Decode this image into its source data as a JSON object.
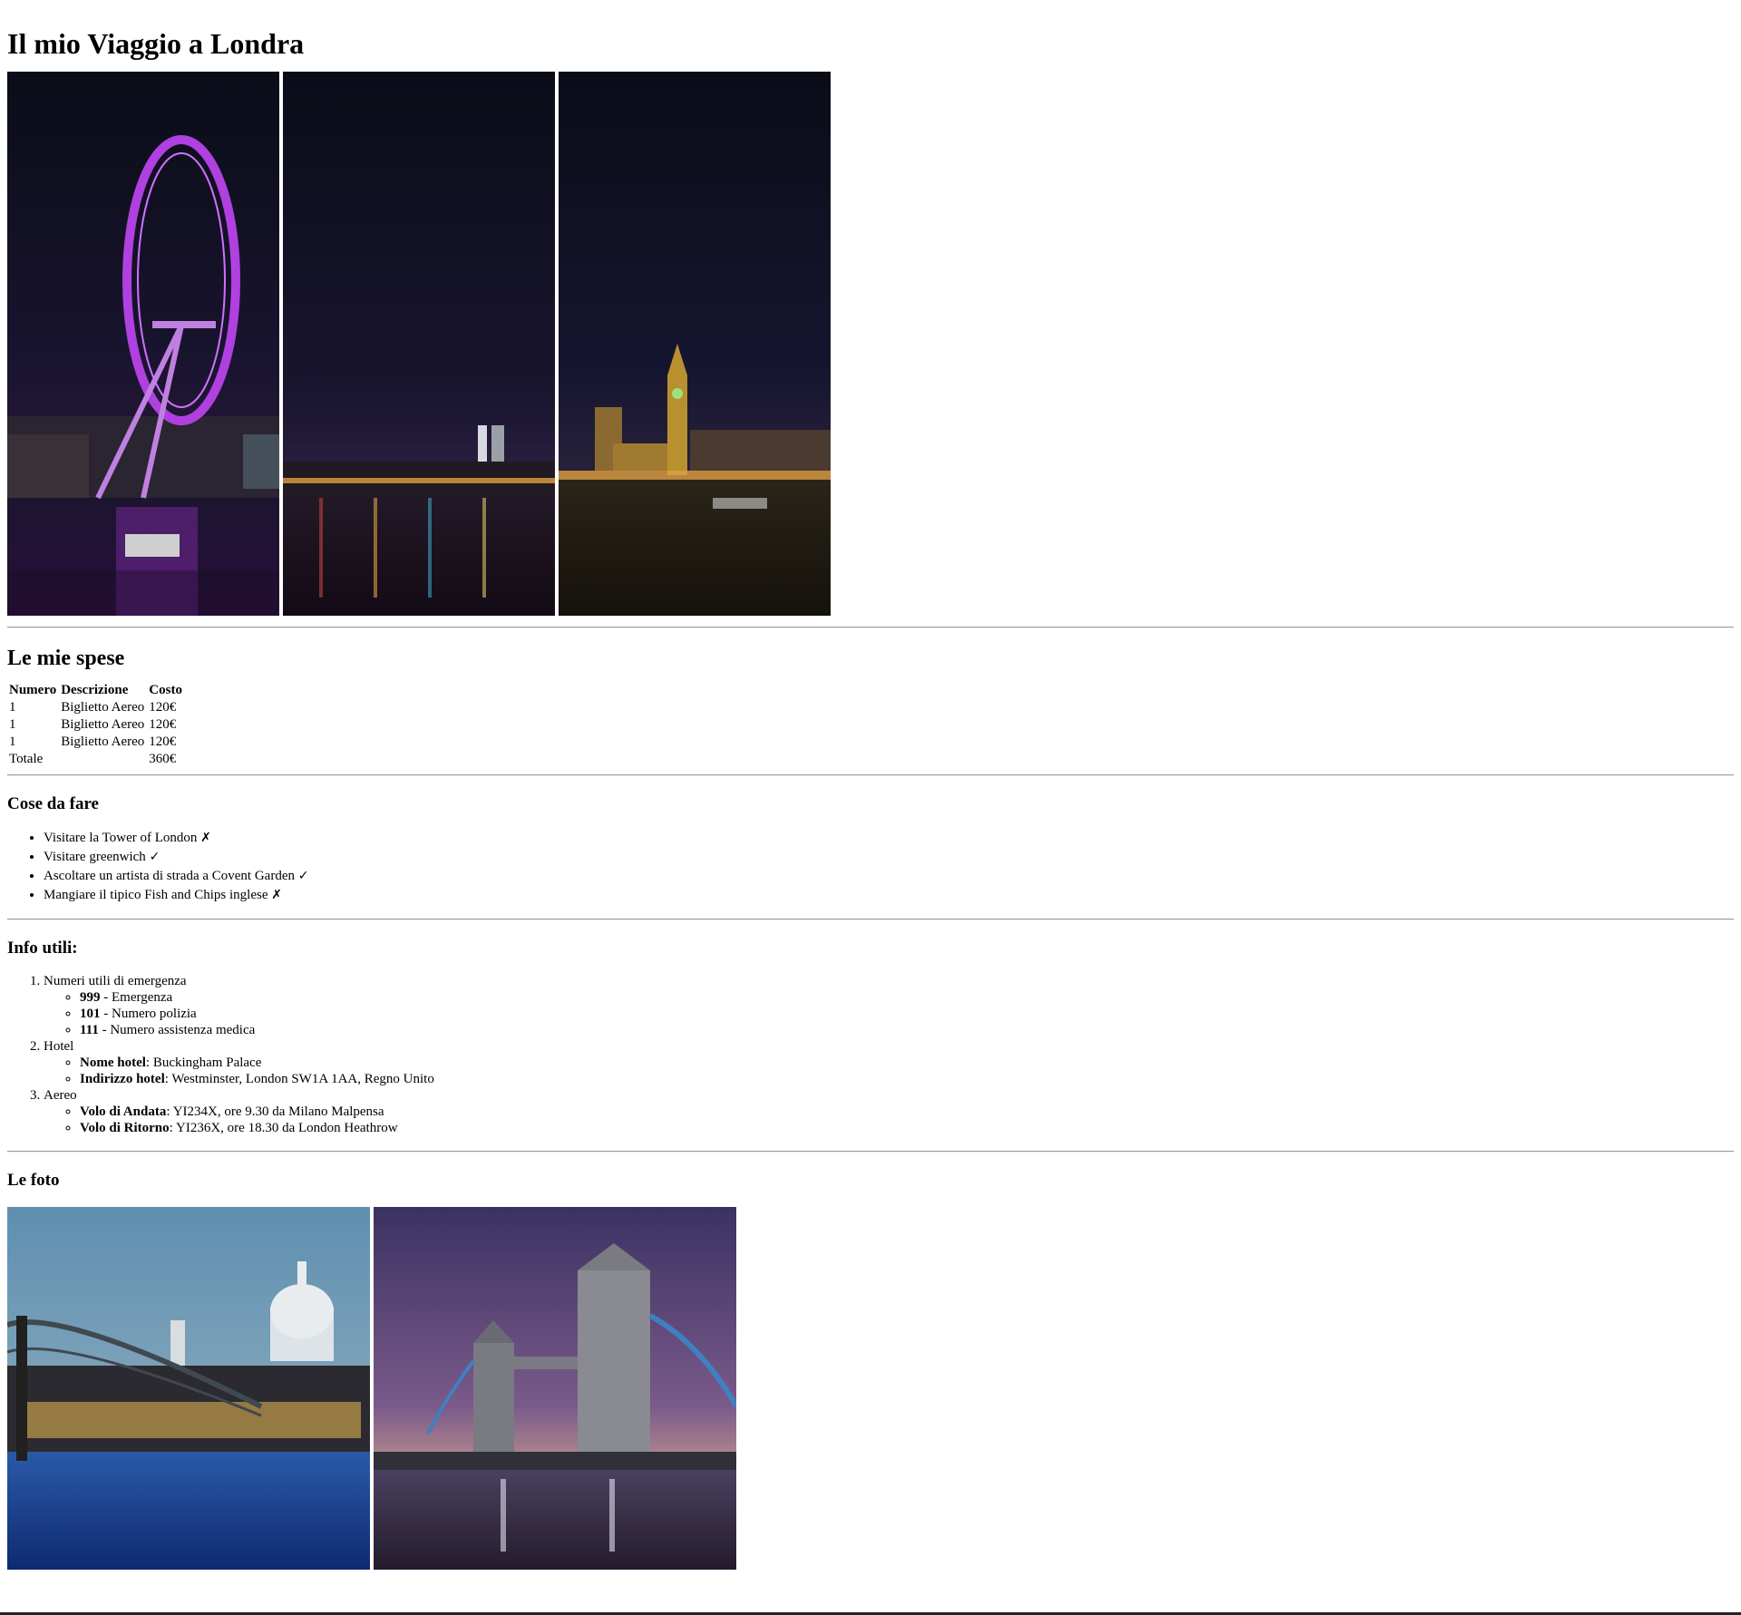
{
  "title": "Il mio Viaggio a Londra",
  "spese": {
    "heading": "Le mie spese",
    "headers": [
      "Numero",
      "Descrizione",
      "Costo"
    ],
    "rows": [
      {
        "numero": "1",
        "descrizione": "Biglietto Aereo",
        "costo": "120€"
      },
      {
        "numero": "1",
        "descrizione": "Biglietto Aereo",
        "costo": "120€"
      },
      {
        "numero": "1",
        "descrizione": "Biglietto Aereo",
        "costo": "120€"
      }
    ],
    "total_label": "Totale",
    "total_value": "360€"
  },
  "todo": {
    "heading": "Cose da fare",
    "items": [
      {
        "text": "Visitare la Tower of London",
        "mark": "✗"
      },
      {
        "text": "Visitare greenwich",
        "mark": "✓"
      },
      {
        "text": "Ascoltare un artista di strada a Covent Garden",
        "mark": "✓"
      },
      {
        "text": "Mangiare il tipico Fish and Chips inglese",
        "mark": "✗"
      }
    ]
  },
  "info": {
    "heading": "Info utili:",
    "emergenza": {
      "label": "Numeri utili di emergenza",
      "items": [
        {
          "bold": "999",
          "text": " - Emergenza"
        },
        {
          "bold": "101",
          "text": " - Numero polizia"
        },
        {
          "bold": "111",
          "text": " - Numero assistenza medica"
        }
      ]
    },
    "hotel": {
      "label": "Hotel",
      "items": [
        {
          "bold": "Nome hotel",
          "text": ": Buckingham Palace"
        },
        {
          "bold": "Indirizzo hotel",
          "text": ": Westminster, London SW1A 1AA, Regno Unito"
        }
      ]
    },
    "aereo": {
      "label": "Aereo",
      "items": [
        {
          "bold": "Volo di Andata",
          "text": ": YI234X, ore 9.30 da Milano Malpensa"
        },
        {
          "bold": "Volo di Ritorno",
          "text": ": YI236X, ore 18.30 da London Heathrow"
        }
      ]
    }
  },
  "foto": {
    "heading": "Le foto"
  }
}
